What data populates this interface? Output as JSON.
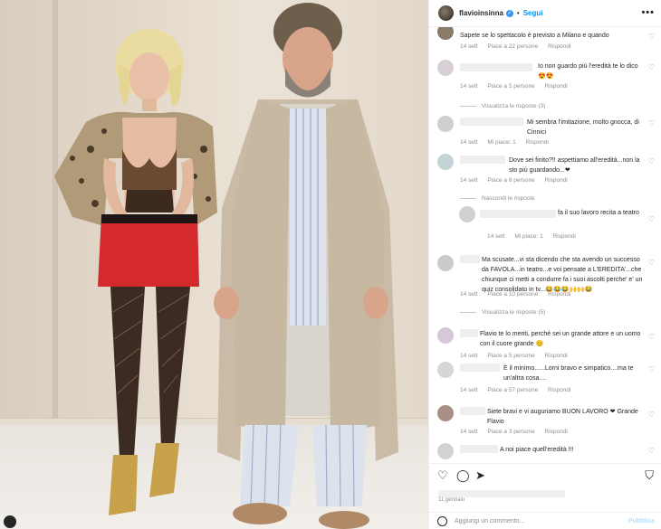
{
  "post": {
    "username": "flavioinsinna",
    "follow_label": "Segui",
    "date": "11 gennaio",
    "more_label": "•••"
  },
  "comments": [
    {
      "text": "Sapete se lo spettacolo è previsto a Milano e quando",
      "time": "14 sett",
      "likes": "Piace a 22 persone",
      "reply": "Rispondi"
    },
    {
      "text": "Io non guardo più l'eredità te lo dico 😍😍",
      "time": "14 sett",
      "likes": "Piace a 5 persone",
      "reply": "Rispondi",
      "view_replies": "Visualizza le risposte (3)"
    },
    {
      "text": "Mi sembra l'imitazione, molto gnocca, di Cinnici",
      "time": "14 sett",
      "likes": "Mi piace: 1",
      "reply": "Rispondi"
    },
    {
      "text": "Dove sei finito?!! aspettiamo all'eredità...non la sto più guardando...❤",
      "time": "14 sett",
      "likes": "Piace a 6 persone",
      "reply": "Rispondi",
      "view_replies": "Nascondi le risposte"
    },
    {
      "text": "fa il suo lavoro recita a teatro",
      "time": "14 sett",
      "likes": "Mi piace: 1",
      "reply": "Rispondi"
    },
    {
      "text": "Ma scusate...vi sta dicendo che sta avendo un successo da FAVOLA...in teatro...e voi pensate a L'EREDITA'...che chiunque ci metti a condurre fa i suoi ascolti perche' e' un quiz consolidato in tv...😂😂😂🙌🙌😂",
      "time": "14 sett",
      "likes": "Piace a 10 persone",
      "reply": "Rispondi",
      "view_replies": "Visualizza le risposte (5)"
    },
    {
      "text": "Flavio te lo meriti, perché sei un grande attore e un uomo con il cuore grande 😊",
      "time": "14 sett",
      "likes": "Piace a 5 persone",
      "reply": "Rispondi"
    },
    {
      "text": "È il minimo......Lorni bravo e simpatico....ma te un'altra cosa....",
      "time": "14 sett",
      "likes": "Piace a 57 persone",
      "reply": "Rispondi"
    },
    {
      "text": "Siete bravi e vi auguriamo BUON LAVORO ❤ Grande Flavio",
      "time": "14 sett",
      "likes": "Piace a 3 persone",
      "reply": "Rispondi"
    },
    {
      "text": "A noi piace quell'eredità !!!",
      "time": "",
      "likes": "",
      "reply": ""
    }
  ],
  "composer": {
    "placeholder": "Aggiungi un commento...",
    "publish_label": "Pubblica"
  },
  "colors": {
    "link_blue": "#0095f6",
    "muted_text": "#8e8e8e",
    "jacket": "#c9bba6"
  },
  "icons": [
    "heart-icon",
    "comment-icon",
    "share-icon",
    "bookmark-icon",
    "emoji-icon",
    "more-icon"
  ]
}
